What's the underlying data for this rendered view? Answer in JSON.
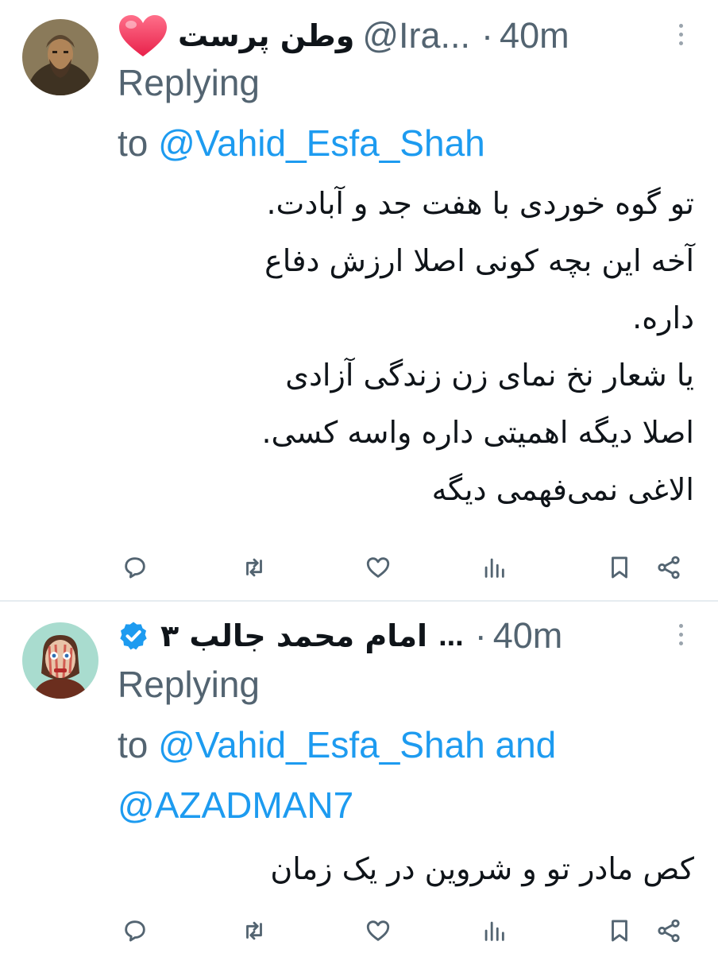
{
  "tweets": [
    {
      "display_name": "وطن پرست",
      "handle": "@Ira...",
      "separator": "·",
      "time": "40m",
      "replying_label": "Replying",
      "replying_to": "to",
      "mentions": [
        "@Vahid_Esfa_Shah"
      ],
      "body_lines": [
        "تو گوه خوردی با هفت جد و آبادت.",
        "آخه این بچه کونی اصلا ارزش دفاع",
        "داره.",
        "یا شعار نخ نمای زن زندگی آزادی",
        "اصلا دیگه اهمیتی داره واسه کسی.",
        "الاغی نمی‌فهمی دیگه"
      ],
      "name_icon": "heart-icon"
    },
    {
      "display_name": "امام محمد جالب ۳",
      "handle": "...",
      "separator": "·",
      "time": "40m",
      "replying_label": "Replying",
      "replying_to": "to",
      "mentions": [
        "@Vahid_Esfa_Shah",
        "@AZADMAN7"
      ],
      "conjunction": "and",
      "body_lines": [
        "کص مادر تو و شروین در یک زمان"
      ],
      "name_icon": "verified-icon"
    }
  ],
  "action_icons": [
    "reply-icon",
    "retweet-icon",
    "like-icon",
    "views-icon",
    "bookmark-icon",
    "share-icon"
  ],
  "colors": {
    "accent": "#1d9bf0",
    "muted": "#536471",
    "text": "#0f1419",
    "heart": "#f0385f"
  }
}
